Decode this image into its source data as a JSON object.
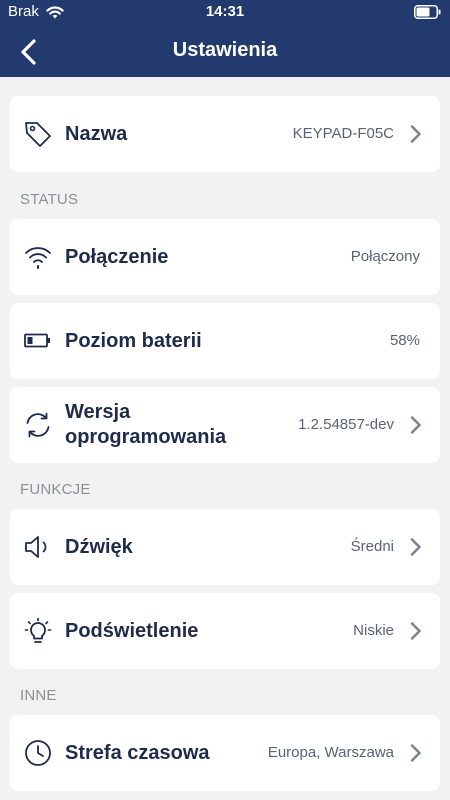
{
  "status_bar": {
    "carrier": "Brak",
    "time": "14:31"
  },
  "nav": {
    "title": "Ustawienia"
  },
  "name_row": {
    "label": "Nazwa",
    "value": "KEYPAD-F05C"
  },
  "sections": {
    "status": "STATUS",
    "functions": "FUNKCJE",
    "other": "INNE"
  },
  "connection": {
    "label": "Połączenie",
    "value": "Połączony"
  },
  "battery": {
    "label": "Poziom baterii",
    "value": "58%"
  },
  "firmware": {
    "label_line1": "Wersja",
    "label_line2": "oprogramowania",
    "value": "1.2.54857-dev"
  },
  "sound": {
    "label": "Dźwięk",
    "value": "Średni"
  },
  "backlight": {
    "label": "Podświetlenie",
    "value": "Niskie"
  },
  "timezone": {
    "label": "Strefa czasowa",
    "value": "Europa, Warszawa"
  },
  "colors": {
    "header_bg": "#223a6e",
    "page_bg": "#f2f2f2",
    "label_text": "#1f2b4a",
    "section_text": "#8a8f98"
  }
}
